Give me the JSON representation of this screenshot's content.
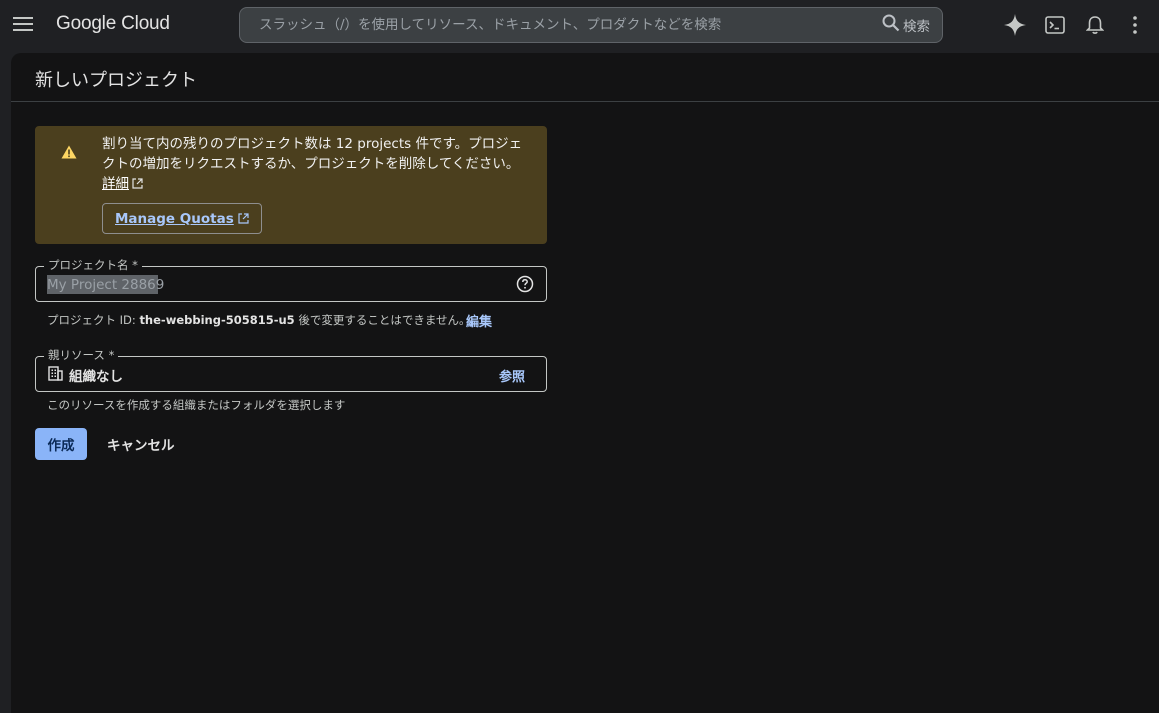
{
  "header": {
    "logo": "Google Cloud",
    "search_placeholder": "スラッシュ（/）を使用してリソース、ドキュメント、プロダクトなどを検索",
    "search_button_label": "検索"
  },
  "page": {
    "title": "新しいプロジェクト"
  },
  "warning": {
    "text": "割り当て内の残りのプロジェクト数は 12 projects 件です。プロジェクトの増加をリクエストするか、プロジェクトを削除してください。",
    "details_link": "詳細",
    "manage_quotas_label": "Manage Quotas"
  },
  "project_name": {
    "label": "プロジェクト名 *",
    "value": "My Project 28869"
  },
  "project_id": {
    "prefix": "プロジェクト ID: ",
    "id": "the-webbing-505815-u5",
    "suffix": " 後で変更することはできません。",
    "edit_label": "編集"
  },
  "parent_resource": {
    "label": "親リソース *",
    "value": "組織なし",
    "browse_label": "参照",
    "hint": "このリソースを作成する組織またはフォルダを選択します"
  },
  "actions": {
    "create_label": "作成",
    "cancel_label": "キャンセル"
  },
  "colors": {
    "accent": "#8ab4f8",
    "link": "#a8c7fa",
    "warning_bg": "#4b3f1e",
    "warning_icon": "#fdd663"
  },
  "icons": [
    "menu-icon",
    "search-icon",
    "gemini-spark-icon",
    "cloud-shell-icon",
    "bell-icon",
    "more-vert-icon",
    "warning-icon",
    "external-link-icon",
    "help-icon",
    "organization-icon"
  ]
}
